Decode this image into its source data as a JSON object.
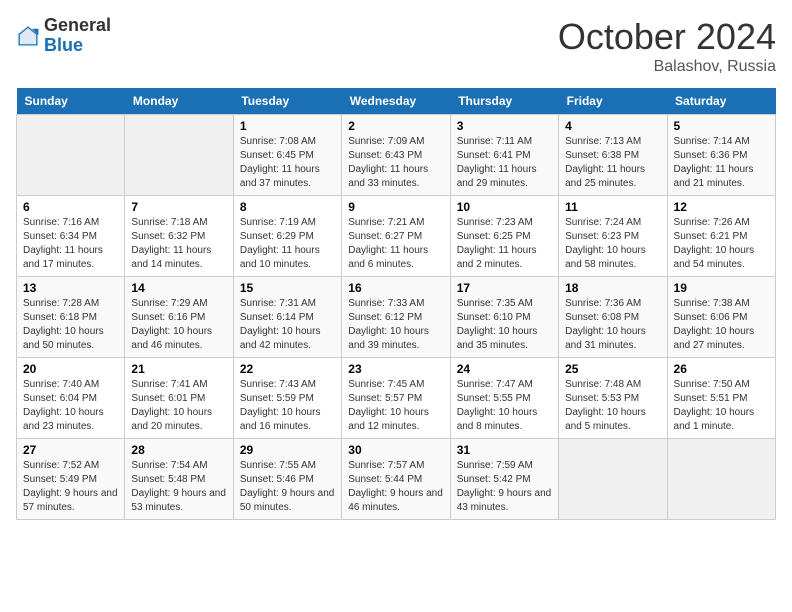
{
  "header": {
    "logo_general": "General",
    "logo_blue": "Blue",
    "month_title": "October 2024",
    "subtitle": "Balashov, Russia"
  },
  "days_of_week": [
    "Sunday",
    "Monday",
    "Tuesday",
    "Wednesday",
    "Thursday",
    "Friday",
    "Saturday"
  ],
  "weeks": [
    [
      {
        "day": "",
        "info": ""
      },
      {
        "day": "",
        "info": ""
      },
      {
        "day": "1",
        "info": "Sunrise: 7:08 AM\nSunset: 6:45 PM\nDaylight: 11 hours and 37 minutes."
      },
      {
        "day": "2",
        "info": "Sunrise: 7:09 AM\nSunset: 6:43 PM\nDaylight: 11 hours and 33 minutes."
      },
      {
        "day": "3",
        "info": "Sunrise: 7:11 AM\nSunset: 6:41 PM\nDaylight: 11 hours and 29 minutes."
      },
      {
        "day": "4",
        "info": "Sunrise: 7:13 AM\nSunset: 6:38 PM\nDaylight: 11 hours and 25 minutes."
      },
      {
        "day": "5",
        "info": "Sunrise: 7:14 AM\nSunset: 6:36 PM\nDaylight: 11 hours and 21 minutes."
      }
    ],
    [
      {
        "day": "6",
        "info": "Sunrise: 7:16 AM\nSunset: 6:34 PM\nDaylight: 11 hours and 17 minutes."
      },
      {
        "day": "7",
        "info": "Sunrise: 7:18 AM\nSunset: 6:32 PM\nDaylight: 11 hours and 14 minutes."
      },
      {
        "day": "8",
        "info": "Sunrise: 7:19 AM\nSunset: 6:29 PM\nDaylight: 11 hours and 10 minutes."
      },
      {
        "day": "9",
        "info": "Sunrise: 7:21 AM\nSunset: 6:27 PM\nDaylight: 11 hours and 6 minutes."
      },
      {
        "day": "10",
        "info": "Sunrise: 7:23 AM\nSunset: 6:25 PM\nDaylight: 11 hours and 2 minutes."
      },
      {
        "day": "11",
        "info": "Sunrise: 7:24 AM\nSunset: 6:23 PM\nDaylight: 10 hours and 58 minutes."
      },
      {
        "day": "12",
        "info": "Sunrise: 7:26 AM\nSunset: 6:21 PM\nDaylight: 10 hours and 54 minutes."
      }
    ],
    [
      {
        "day": "13",
        "info": "Sunrise: 7:28 AM\nSunset: 6:18 PM\nDaylight: 10 hours and 50 minutes."
      },
      {
        "day": "14",
        "info": "Sunrise: 7:29 AM\nSunset: 6:16 PM\nDaylight: 10 hours and 46 minutes."
      },
      {
        "day": "15",
        "info": "Sunrise: 7:31 AM\nSunset: 6:14 PM\nDaylight: 10 hours and 42 minutes."
      },
      {
        "day": "16",
        "info": "Sunrise: 7:33 AM\nSunset: 6:12 PM\nDaylight: 10 hours and 39 minutes."
      },
      {
        "day": "17",
        "info": "Sunrise: 7:35 AM\nSunset: 6:10 PM\nDaylight: 10 hours and 35 minutes."
      },
      {
        "day": "18",
        "info": "Sunrise: 7:36 AM\nSunset: 6:08 PM\nDaylight: 10 hours and 31 minutes."
      },
      {
        "day": "19",
        "info": "Sunrise: 7:38 AM\nSunset: 6:06 PM\nDaylight: 10 hours and 27 minutes."
      }
    ],
    [
      {
        "day": "20",
        "info": "Sunrise: 7:40 AM\nSunset: 6:04 PM\nDaylight: 10 hours and 23 minutes."
      },
      {
        "day": "21",
        "info": "Sunrise: 7:41 AM\nSunset: 6:01 PM\nDaylight: 10 hours and 20 minutes."
      },
      {
        "day": "22",
        "info": "Sunrise: 7:43 AM\nSunset: 5:59 PM\nDaylight: 10 hours and 16 minutes."
      },
      {
        "day": "23",
        "info": "Sunrise: 7:45 AM\nSunset: 5:57 PM\nDaylight: 10 hours and 12 minutes."
      },
      {
        "day": "24",
        "info": "Sunrise: 7:47 AM\nSunset: 5:55 PM\nDaylight: 10 hours and 8 minutes."
      },
      {
        "day": "25",
        "info": "Sunrise: 7:48 AM\nSunset: 5:53 PM\nDaylight: 10 hours and 5 minutes."
      },
      {
        "day": "26",
        "info": "Sunrise: 7:50 AM\nSunset: 5:51 PM\nDaylight: 10 hours and 1 minute."
      }
    ],
    [
      {
        "day": "27",
        "info": "Sunrise: 7:52 AM\nSunset: 5:49 PM\nDaylight: 9 hours and 57 minutes."
      },
      {
        "day": "28",
        "info": "Sunrise: 7:54 AM\nSunset: 5:48 PM\nDaylight: 9 hours and 53 minutes."
      },
      {
        "day": "29",
        "info": "Sunrise: 7:55 AM\nSunset: 5:46 PM\nDaylight: 9 hours and 50 minutes."
      },
      {
        "day": "30",
        "info": "Sunrise: 7:57 AM\nSunset: 5:44 PM\nDaylight: 9 hours and 46 minutes."
      },
      {
        "day": "31",
        "info": "Sunrise: 7:59 AM\nSunset: 5:42 PM\nDaylight: 9 hours and 43 minutes."
      },
      {
        "day": "",
        "info": ""
      },
      {
        "day": "",
        "info": ""
      }
    ]
  ]
}
